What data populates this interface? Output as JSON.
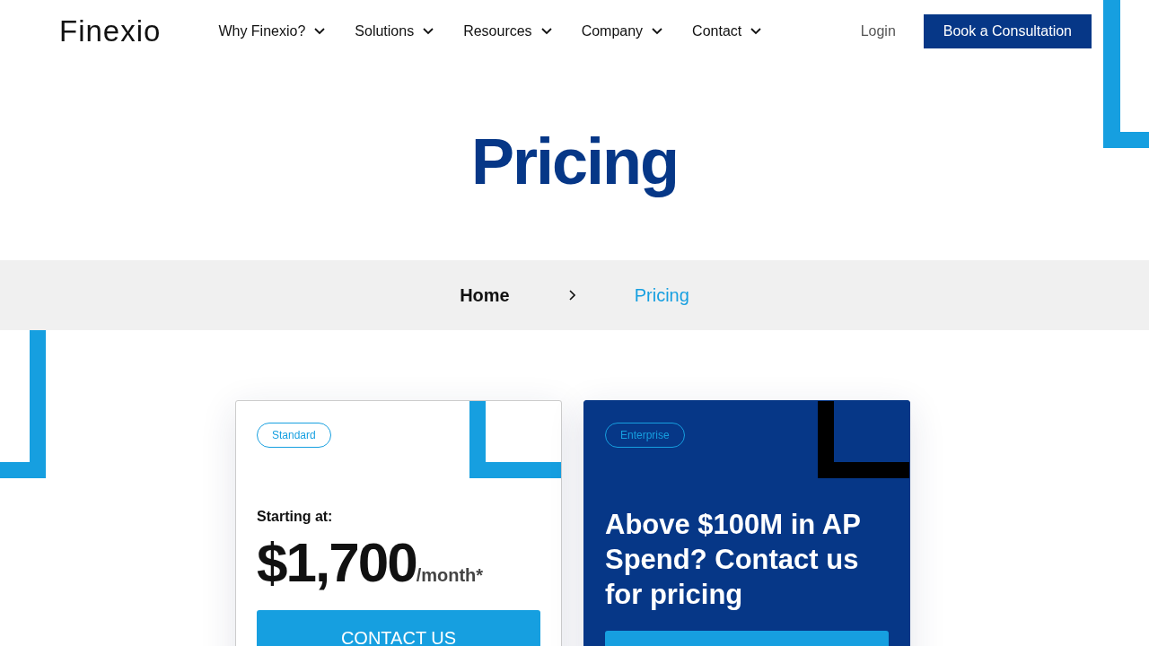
{
  "logo": {
    "text": "Finexio"
  },
  "nav": {
    "items": [
      {
        "label": "Why Finexio?"
      },
      {
        "label": "Solutions"
      },
      {
        "label": "Resources"
      },
      {
        "label": "Company"
      },
      {
        "label": "Contact"
      }
    ],
    "login": "Login",
    "cta": "Book a Consultation"
  },
  "hero": {
    "title": "Pricing"
  },
  "breadcrumb": [
    {
      "label": "Home",
      "selected": false
    },
    {
      "label": "Pricing",
      "selected": true
    }
  ],
  "plans": [
    {
      "kind": "price",
      "tag": "Standard",
      "caption": "Starting at:",
      "price": "$1,700",
      "unit": "/month*",
      "button": "CONTACT US"
    },
    {
      "kind": "contact",
      "tag": "Enterprise",
      "heading": "Above $100M in AP Spend? Contact us for pricing"
    }
  ]
}
